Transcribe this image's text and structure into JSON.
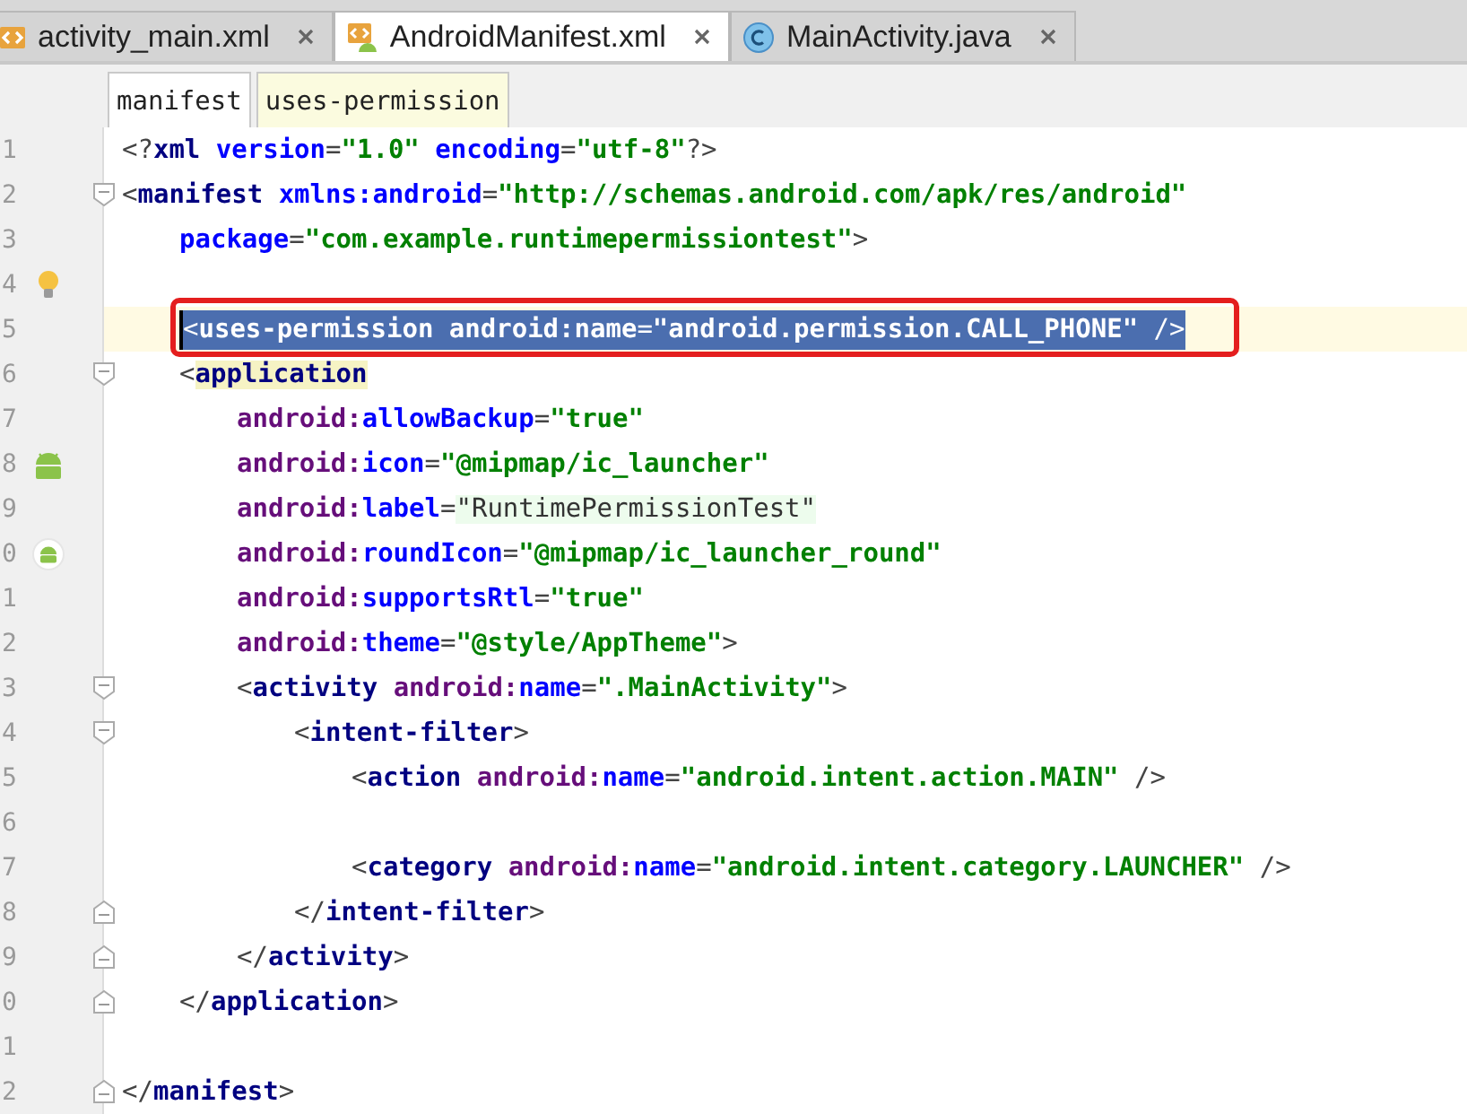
{
  "tabs": [
    {
      "label": "activity_main.xml",
      "kind": "xml",
      "selected": false
    },
    {
      "label": "AndroidManifest.xml",
      "kind": "manifest",
      "selected": true
    },
    {
      "label": "MainActivity.java",
      "kind": "class",
      "selected": false
    }
  ],
  "breadcrumbs": [
    {
      "label": "manifest",
      "selected": false
    },
    {
      "label": "uses-permission",
      "selected": true
    }
  ],
  "lines": [
    {
      "number": "1",
      "selected": false,
      "boxed": false,
      "words": [
        [
          {
            "kind": "punct",
            "text": "<?"
          },
          {
            "kind": "tag",
            "text": "xml"
          }
        ],
        [
          {
            "kind": "attr",
            "text": "version"
          },
          {
            "kind": "punct",
            "text": "="
          },
          {
            "kind": "value",
            "text": "\"1.0\""
          }
        ],
        [
          {
            "kind": "attr",
            "text": "encoding"
          },
          {
            "kind": "punct",
            "text": "="
          },
          {
            "kind": "value",
            "text": "\"utf-8\""
          },
          {
            "kind": "punct",
            "text": "?>"
          }
        ]
      ]
    },
    {
      "number": "2",
      "selected": false,
      "boxed": false,
      "fold": {
        "kind": "start"
      },
      "words": [
        [
          {
            "kind": "punct",
            "text": "<"
          },
          {
            "kind": "tag",
            "text": "manifest"
          }
        ],
        [
          {
            "kind": "attr",
            "text": "xmlns:android"
          },
          {
            "kind": "punct",
            "text": "="
          },
          {
            "kind": "value",
            "text": "\"http://schemas.android.com/apk/res/android\""
          }
        ]
      ],
      "children": [
        {
          "number": "3",
          "selected": false,
          "boxed": false,
          "words": [
            [
              {
                "kind": "attr",
                "text": "package"
              },
              {
                "kind": "punct",
                "text": "="
              },
              {
                "kind": "value",
                "text": "\"com.example.runtimepermissiontest\""
              },
              {
                "kind": "punct",
                "text": ">"
              }
            ]
          ]
        },
        {
          "number": "4",
          "selected": false,
          "boxed": false,
          "gutter_icon": {
            "kind": "bulb"
          }
        },
        {
          "number": "5",
          "selected": true,
          "boxed": true,
          "words": [
            [
              {
                "kind": "punct",
                "text": "<"
              },
              {
                "kind": "tag",
                "text": "uses-permission"
              }
            ],
            [
              {
                "kind": "ns",
                "text": "android:"
              },
              {
                "kind": "attr",
                "text": "name"
              },
              {
                "kind": "punct",
                "text": "="
              },
              {
                "kind": "value",
                "text": "\"android.permission.CALL_PHONE\""
              }
            ],
            [
              {
                "kind": "punct",
                "text": "/>"
              }
            ]
          ]
        },
        {
          "number": "6",
          "selected": false,
          "boxed": false,
          "fold": {
            "kind": "start"
          },
          "words": [
            [
              {
                "kind": "punct",
                "text": "<"
              },
              {
                "kind": "tag_matched",
                "text": "application"
              }
            ]
          ],
          "children": [
            {
              "number": "7",
              "selected": false,
              "boxed": false,
              "words": [
                [
                  {
                    "kind": "ns",
                    "text": "android:"
                  },
                  {
                    "kind": "attr",
                    "text": "allowBackup"
                  },
                  {
                    "kind": "punct",
                    "text": "="
                  },
                  {
                    "kind": "value",
                    "text": "\"true\""
                  }
                ]
              ]
            },
            {
              "number": "8",
              "selected": false,
              "boxed": false,
              "gutter_icon": {
                "kind": "android"
              },
              "words": [
                [
                  {
                    "kind": "ns",
                    "text": "android:"
                  },
                  {
                    "kind": "attr",
                    "text": "icon"
                  },
                  {
                    "kind": "punct",
                    "text": "="
                  },
                  {
                    "kind": "value",
                    "text": "\"@mipmap/ic_launcher\""
                  }
                ]
              ]
            },
            {
              "number": "9",
              "selected": false,
              "boxed": false,
              "words": [
                [
                  {
                    "kind": "ns",
                    "text": "android:"
                  },
                  {
                    "kind": "attr",
                    "text": "label"
                  },
                  {
                    "kind": "punct",
                    "text": "="
                  },
                  {
                    "kind": "string",
                    "text": "\"RuntimePermissionTest\""
                  }
                ]
              ]
            },
            {
              "number": "0",
              "selected": false,
              "boxed": false,
              "gutter_icon": {
                "kind": "android_round"
              },
              "words": [
                [
                  {
                    "kind": "ns",
                    "text": "android:"
                  },
                  {
                    "kind": "attr",
                    "text": "roundIcon"
                  },
                  {
                    "kind": "punct",
                    "text": "="
                  },
                  {
                    "kind": "value",
                    "text": "\"@mipmap/ic_launcher_round\""
                  }
                ]
              ]
            },
            {
              "number": "1",
              "selected": false,
              "boxed": false,
              "words": [
                [
                  {
                    "kind": "ns",
                    "text": "android:"
                  },
                  {
                    "kind": "attr",
                    "text": "supportsRtl"
                  },
                  {
                    "kind": "punct",
                    "text": "="
                  },
                  {
                    "kind": "value",
                    "text": "\"true\""
                  }
                ]
              ]
            },
            {
              "number": "2",
              "selected": false,
              "boxed": false,
              "words": [
                [
                  {
                    "kind": "ns",
                    "text": "android:"
                  },
                  {
                    "kind": "attr",
                    "text": "theme"
                  },
                  {
                    "kind": "punct",
                    "text": "="
                  },
                  {
                    "kind": "value",
                    "text": "\"@style/AppTheme\""
                  },
                  {
                    "kind": "punct",
                    "text": ">"
                  }
                ]
              ]
            },
            {
              "number": "3",
              "selected": false,
              "boxed": false,
              "fold": {
                "kind": "start"
              },
              "words": [
                [
                  {
                    "kind": "punct",
                    "text": "<"
                  },
                  {
                    "kind": "tag",
                    "text": "activity"
                  }
                ],
                [
                  {
                    "kind": "ns",
                    "text": "android:"
                  },
                  {
                    "kind": "attr",
                    "text": "name"
                  },
                  {
                    "kind": "punct",
                    "text": "="
                  },
                  {
                    "kind": "value",
                    "text": "\".MainActivity\""
                  },
                  {
                    "kind": "punct",
                    "text": ">"
                  }
                ]
              ],
              "children": [
                {
                  "number": "4",
                  "selected": false,
                  "boxed": false,
                  "fold": {
                    "kind": "start"
                  },
                  "words": [
                    [
                      {
                        "kind": "punct",
                        "text": "<"
                      },
                      {
                        "kind": "tag",
                        "text": "intent-filter"
                      },
                      {
                        "kind": "punct",
                        "text": ">"
                      }
                    ]
                  ],
                  "children": [
                    {
                      "number": "5",
                      "selected": false,
                      "boxed": false,
                      "words": [
                        [
                          {
                            "kind": "punct",
                            "text": "<"
                          },
                          {
                            "kind": "tag",
                            "text": "action"
                          }
                        ],
                        [
                          {
                            "kind": "ns",
                            "text": "android:"
                          },
                          {
                            "kind": "attr",
                            "text": "name"
                          },
                          {
                            "kind": "punct",
                            "text": "="
                          },
                          {
                            "kind": "value",
                            "text": "\"android.intent.action.MAIN\""
                          }
                        ],
                        [
                          {
                            "kind": "punct",
                            "text": "/>"
                          }
                        ]
                      ]
                    },
                    {
                      "number": "6",
                      "selected": false,
                      "boxed": false
                    },
                    {
                      "number": "7",
                      "selected": false,
                      "boxed": false,
                      "words": [
                        [
                          {
                            "kind": "punct",
                            "text": "<"
                          },
                          {
                            "kind": "tag",
                            "text": "category"
                          }
                        ],
                        [
                          {
                            "kind": "ns",
                            "text": "android:"
                          },
                          {
                            "kind": "attr",
                            "text": "name"
                          },
                          {
                            "kind": "punct",
                            "text": "="
                          },
                          {
                            "kind": "value",
                            "text": "\"android.intent.category.LAUNCHER\""
                          }
                        ],
                        [
                          {
                            "kind": "punct",
                            "text": "/>"
                          }
                        ]
                      ]
                    }
                  ]
                },
                {
                  "number": "8",
                  "selected": false,
                  "boxed": false,
                  "fold": {
                    "kind": "end"
                  },
                  "words": [
                    [
                      {
                        "kind": "punct",
                        "text": "</"
                      },
                      {
                        "kind": "tag",
                        "text": "intent-filter"
                      },
                      {
                        "kind": "punct",
                        "text": ">"
                      }
                    ]
                  ]
                }
              ]
            },
            {
              "number": "9",
              "selected": false,
              "boxed": false,
              "fold": {
                "kind": "end"
              },
              "words": [
                [
                  {
                    "kind": "punct",
                    "text": "</"
                  },
                  {
                    "kind": "tag",
                    "text": "activity"
                  },
                  {
                    "kind": "punct",
                    "text": ">"
                  }
                ]
              ]
            }
          ]
        },
        {
          "number": "0",
          "selected": false,
          "boxed": false,
          "fold": {
            "kind": "end"
          },
          "words": [
            [
              {
                "kind": "punct",
                "text": "</"
              },
              {
                "kind": "tag",
                "text": "application"
              },
              {
                "kind": "punct",
                "text": ">"
              }
            ]
          ]
        },
        {
          "number": "1",
          "selected": false,
          "boxed": false
        }
      ]
    },
    {
      "number": "2",
      "selected": false,
      "boxed": false,
      "fold": {
        "kind": "end"
      },
      "words": [
        [
          {
            "kind": "punct",
            "text": "</"
          },
          {
            "kind": "tag",
            "text": "manifest"
          },
          {
            "kind": "punct",
            "text": ">"
          }
        ]
      ]
    }
  ]
}
